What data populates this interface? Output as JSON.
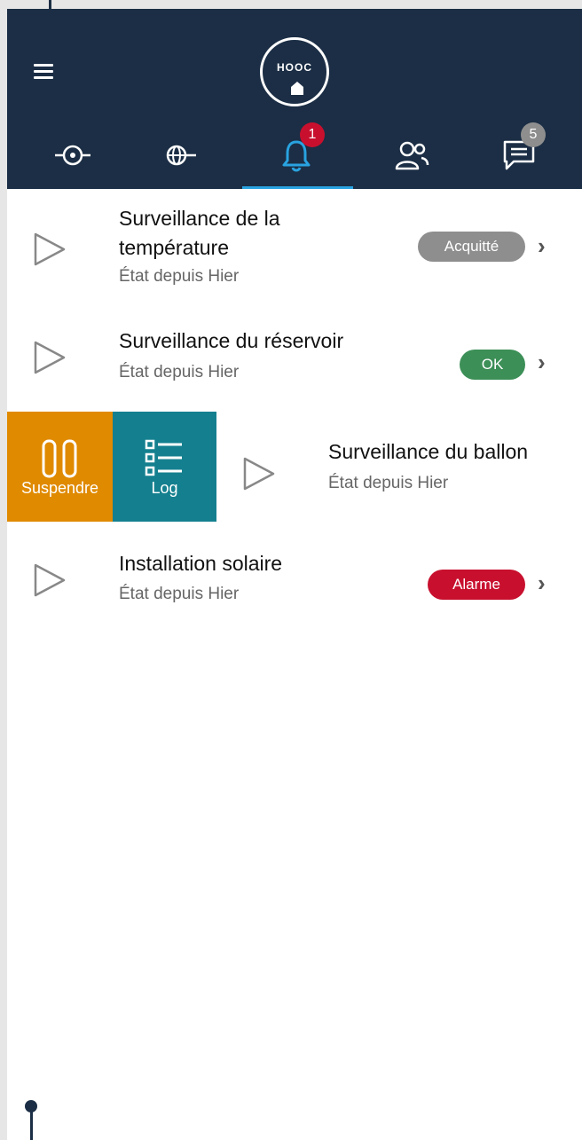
{
  "header": {
    "logo_text": "HOOC",
    "tabs": [
      {
        "name": "sensors",
        "icon": "sensor-icon"
      },
      {
        "name": "network",
        "icon": "globe-icon"
      },
      {
        "name": "alerts",
        "icon": "bell-icon",
        "badge": "1",
        "active": true
      },
      {
        "name": "users",
        "icon": "users-icon"
      },
      {
        "name": "messages",
        "icon": "chat-icon",
        "badge": "5"
      }
    ]
  },
  "rows": [
    {
      "title_line1": "Surveillance de la",
      "title_line2": "température",
      "subtitle": "État depuis Hier",
      "status": "Acquitté",
      "status_color": "#8e8e8e"
    },
    {
      "title_line1": "Surveillance du réservoir",
      "subtitle": "État depuis Hier",
      "status": "OK",
      "status_color": "#3c8f57"
    },
    {
      "title_line1": "Surveillance du ballon",
      "subtitle": "État depuis Hier"
    },
    {
      "title_line1": "Installation solaire",
      "subtitle": "État depuis Hier",
      "status": "Alarme",
      "status_color": "#c8102e"
    }
  ],
  "swipe_actions": {
    "suspend_label": "Suspendre",
    "log_label": "Log"
  },
  "colors": {
    "header_bg": "#1b2e45",
    "accent": "#29a3e0",
    "suspend": "#e08a00",
    "log": "#14808f"
  }
}
